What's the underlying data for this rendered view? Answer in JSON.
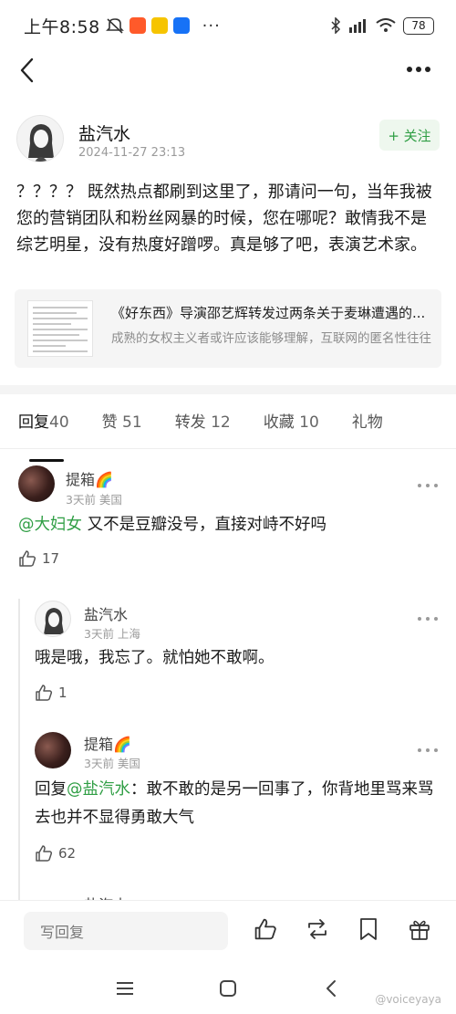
{
  "status_bar": {
    "time": "上午8:58",
    "dots": "···",
    "battery": "78"
  },
  "post": {
    "author": "盐汽水",
    "timestamp": "2024-11-27 23:13",
    "follow_label": "+ 关注",
    "body": "？？？？ 既然热点都刷到这里了，那请问一句，当年我被您的营销团队和粉丝网暴的时候，您在哪呢？敢情我不是综艺明星，没有热度好蹭啰。真是够了吧，表演艺术家。",
    "quote": {
      "title": "《好东西》导演邵艺辉转发过两条关于麦琳遭遇的...",
      "subtitle": "成熟的女权主义者或许应该能够理解，互联网的匿名性往往"
    }
  },
  "tabs": [
    {
      "label": "回复",
      "count": "40"
    },
    {
      "label": "赞",
      "count": "51"
    },
    {
      "label": "转发",
      "count": "12"
    },
    {
      "label": "收藏",
      "count": "10"
    },
    {
      "label": "礼物",
      "count": ""
    }
  ],
  "comments": {
    "c1": {
      "name": "提箱🌈",
      "meta": "3天前 美国",
      "mention": "@大妇女",
      "text": " 又不是豆瓣没号，直接对峙不好吗",
      "likes": "17"
    },
    "c2": {
      "name": "盐汽水",
      "meta": "3天前 上海",
      "text": "哦是哦，我忘了。就怕她不敢啊。",
      "likes": "1"
    },
    "c3": {
      "name": "提箱🌈",
      "meta": "3天前 美国",
      "prefix": "回复",
      "mention": "@盐汽水",
      "text": "：敢不敢的是另一回事了，你背地里骂来骂去也并不显得勇敢大气",
      "likes": "62"
    },
    "c4_partial_name": "盐汽水"
  },
  "bottom_bar": {
    "reply_placeholder": "写回复"
  },
  "watermark": "@voiceyaya",
  "colors": {
    "accent_green": "#2f9e44",
    "follow_bg": "#eef7ee"
  }
}
